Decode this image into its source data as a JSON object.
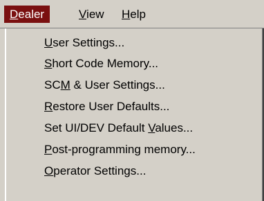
{
  "menubar": {
    "items": [
      {
        "pre": "",
        "key": "D",
        "post": "ealer",
        "active": true
      },
      {
        "pre": "",
        "key": "V",
        "post": "iew",
        "active": false
      },
      {
        "pre": "",
        "key": "H",
        "post": "elp",
        "active": false
      }
    ]
  },
  "dropdown": {
    "items": [
      {
        "pre": "",
        "key": "U",
        "post": "ser Settings..."
      },
      {
        "pre": "",
        "key": "S",
        "post": "hort Code Memory..."
      },
      {
        "pre": "SC",
        "key": "M",
        "post": " & User Settings..."
      },
      {
        "pre": "",
        "key": "R",
        "post": "estore User Defaults..."
      },
      {
        "pre": "Set UI/DEV Default ",
        "key": "V",
        "post": "alues..."
      },
      {
        "pre": "",
        "key": "P",
        "post": "ost-programming memory..."
      },
      {
        "pre": "",
        "key": "O",
        "post": "perator Settings..."
      }
    ]
  },
  "colors": {
    "menu_background": "#d4d0c8",
    "active_menu_background": "#7a1010",
    "active_menu_text": "#ffffff"
  }
}
